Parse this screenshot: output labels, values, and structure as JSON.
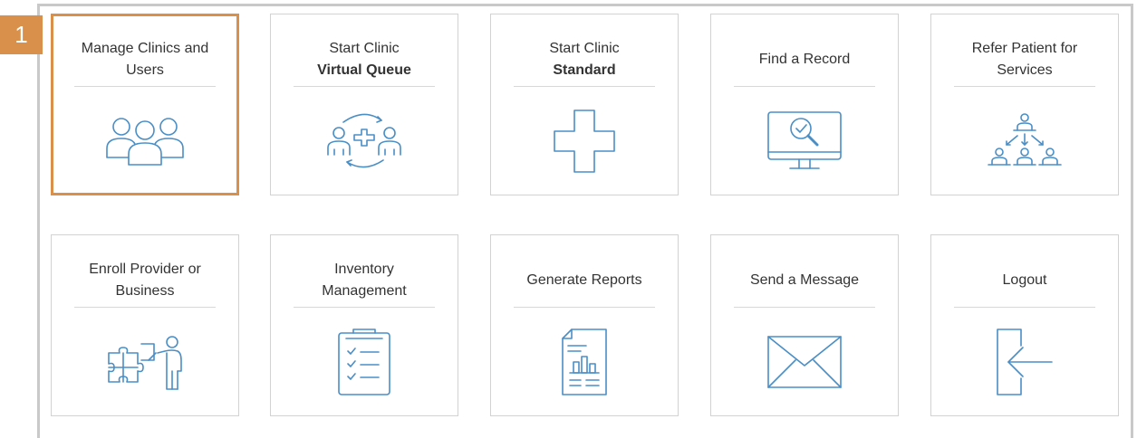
{
  "step_badge": "1",
  "tiles": [
    {
      "line1": "Manage Clinics and",
      "line2": "Users",
      "icon": "users-group-icon"
    },
    {
      "line1": "Start Clinic",
      "line2": "Virtual Queue",
      "icon": "virtual-queue-icon"
    },
    {
      "line1": "Start Clinic",
      "line2": "Standard",
      "icon": "medical-cross-icon"
    },
    {
      "line1": "Find a Record",
      "line2": "",
      "icon": "search-monitor-icon"
    },
    {
      "line1": "Refer Patient for",
      "line2": "Services",
      "icon": "referral-hierarchy-icon"
    },
    {
      "line1": "Enroll Provider or",
      "line2": "Business",
      "icon": "puzzle-presenter-icon"
    },
    {
      "line1": "Inventory",
      "line2": "Management",
      "icon": "checklist-clipboard-icon"
    },
    {
      "line1": "Generate Reports",
      "line2": "",
      "icon": "report-document-icon"
    },
    {
      "line1": "Send a Message",
      "line2": "",
      "icon": "envelope-icon"
    },
    {
      "line1": "Logout",
      "line2": "",
      "icon": "logout-arrow-icon"
    }
  ],
  "colors": {
    "accent": "#d9904a",
    "icon": "#4a8ec6",
    "border": "#d2d2d2"
  }
}
